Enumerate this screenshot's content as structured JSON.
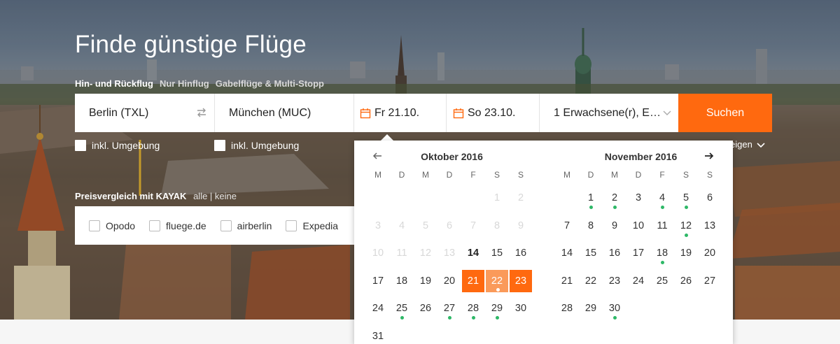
{
  "header": {
    "title": "Finde günstige Flüge",
    "trip_types": [
      "Hin- und Rückflug",
      "Nur Hinflug",
      "Gabelflüge & Multi-Stopp"
    ],
    "active_trip_type": "Hin- und Rückflug"
  },
  "search": {
    "origin": "Berlin (TXL)",
    "destination": "München (MUC)",
    "depart_date": "Fr 21.10.",
    "return_date": "So 23.10.",
    "passengers": "1 Erwachsene(r), E…",
    "search_button": "Suchen",
    "nearby_label_origin": "inkl. Umgebung",
    "nearby_label_destination": "inkl. Umgebung",
    "show_more": "eigen"
  },
  "compare": {
    "title": "Preisvergleich mit KAYAK",
    "link_all": "alle | keine",
    "providers": [
      "Opodo",
      "fluege.de",
      "airberlin",
      "Expedia"
    ]
  },
  "calendar": {
    "weekdays": [
      "M",
      "D",
      "M",
      "D",
      "F",
      "S",
      "S"
    ],
    "months": [
      {
        "title": "Oktober 2016",
        "weeks": [
          [
            "",
            "",
            "",
            "",
            "",
            "1",
            "2"
          ],
          [
            "3",
            "4",
            "5",
            "6",
            "7",
            "8",
            "9"
          ],
          [
            "10",
            "11",
            "12",
            "13",
            "14",
            "15",
            "16"
          ],
          [
            "17",
            "18",
            "19",
            "20",
            "21",
            "22",
            "23"
          ],
          [
            "24",
            "25",
            "26",
            "27",
            "28",
            "29",
            "30"
          ],
          [
            "31",
            "",
            "",
            "",
            "",
            "",
            ""
          ]
        ],
        "past_days": [
          1,
          2,
          3,
          4,
          5,
          6,
          7,
          8,
          9,
          10,
          11,
          12,
          13
        ],
        "today": 14,
        "selected": [
          21,
          23
        ],
        "in_range": [
          22
        ],
        "price_dots": [
          22,
          25,
          27,
          28,
          29
        ]
      },
      {
        "title": "November 2016",
        "weeks": [
          [
            "",
            "1",
            "2",
            "3",
            "4",
            "5",
            "6"
          ],
          [
            "7",
            "8",
            "9",
            "10",
            "11",
            "12",
            "13"
          ],
          [
            "14",
            "15",
            "16",
            "17",
            "18",
            "19",
            "20"
          ],
          [
            "21",
            "22",
            "23",
            "24",
            "25",
            "26",
            "27"
          ],
          [
            "28",
            "29",
            "30",
            "",
            "",
            "",
            ""
          ]
        ],
        "past_days": [],
        "today": null,
        "selected": [],
        "in_range": [],
        "price_dots": [
          1,
          2,
          4,
          5,
          12,
          18,
          30
        ]
      }
    ]
  },
  "colors": {
    "accent": "#ff690f",
    "range": "#fa9a5a",
    "price_dot": "#2eb867"
  },
  "icons": {
    "swap": "swap-arrows-icon",
    "calendar": "calendar-icon",
    "dropdown": "chevron-down-icon",
    "prev": "arrow-left-icon",
    "next": "arrow-right-icon"
  }
}
